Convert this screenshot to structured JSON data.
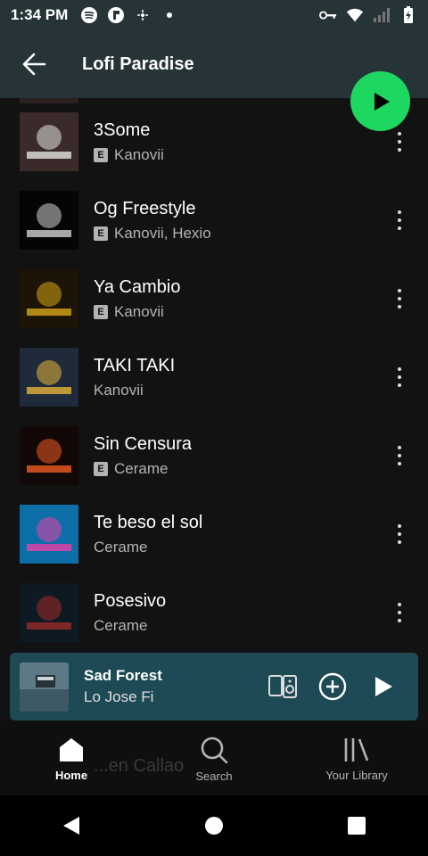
{
  "status_bar": {
    "time": "1:34 PM"
  },
  "header": {
    "title": "Lofi Paradise"
  },
  "tracks": [
    {
      "title": "3Some",
      "artist": "Kanovii",
      "explicit": true,
      "cover_colors": [
        "#3a2a2a",
        "#e3e3e3"
      ]
    },
    {
      "title": "Og Freestyle",
      "artist": "Kanovii, Hexio",
      "explicit": true,
      "cover_colors": [
        "#050505",
        "#cfcfcf"
      ]
    },
    {
      "title": "Ya Cambio",
      "artist": "Kanovii",
      "explicit": true,
      "cover_colors": [
        "#1c1406",
        "#d7a516"
      ]
    },
    {
      "title": "TAKI TAKI",
      "artist": "Kanovii",
      "explicit": false,
      "cover_colors": [
        "#1f2a3a",
        "#e6b43a"
      ]
    },
    {
      "title": "Sin Censura",
      "artist": "Cerame",
      "explicit": true,
      "cover_colors": [
        "#120808",
        "#ef5b22"
      ]
    },
    {
      "title": "Te beso el sol",
      "artist": "Cerame",
      "explicit": false,
      "cover_colors": [
        "#0e6fa8",
        "#ea3ea6"
      ]
    },
    {
      "title": "Posesivo",
      "artist": "Cerame",
      "explicit": false,
      "cover_colors": [
        "#0e1a22",
        "#9c2a2a"
      ]
    }
  ],
  "explicit_label": "E",
  "mini_player": {
    "title": "Sad Forest",
    "artist": "Lo Jose Fi",
    "bg_color": "#1e4a55"
  },
  "ghost_row_text": "...en Callao",
  "bottom_nav": [
    {
      "label": "Home",
      "icon": "home-icon",
      "active": true
    },
    {
      "label": "Search",
      "icon": "search-icon",
      "active": false
    },
    {
      "label": "Your Library",
      "icon": "library-icon",
      "active": false
    }
  ],
  "colors": {
    "accent": "#1ed760",
    "header_bg": "#263438",
    "background": "#121212"
  }
}
